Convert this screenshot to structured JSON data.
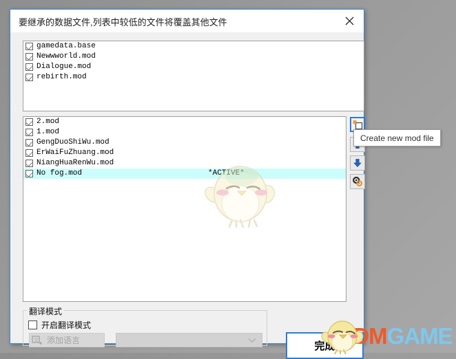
{
  "dialog": {
    "title": "要继承的数据文件,列表中较低的文件将覆盖其他文件",
    "close_icon": "close-icon"
  },
  "inherit_list": {
    "items": [
      {
        "label": "gamedata.base",
        "checked": true
      },
      {
        "label": "Newwworld.mod",
        "checked": true
      },
      {
        "label": "Dialogue.mod",
        "checked": true
      },
      {
        "label": "rebirth.mod",
        "checked": true
      }
    ]
  },
  "mod_list": {
    "active_tag": "*ACTIVE*",
    "items": [
      {
        "label": "2.mod",
        "checked": true,
        "active": false
      },
      {
        "label": "1.mod",
        "checked": true,
        "active": false
      },
      {
        "label": "GengDuoShiWu.mod",
        "checked": true,
        "active": false
      },
      {
        "label": "ErWaiFuZhuang.mod",
        "checked": true,
        "active": false
      },
      {
        "label": "NiangHuaRenWu.mod",
        "checked": true,
        "active": false
      },
      {
        "label": "No fog.mod",
        "checked": true,
        "active": true
      }
    ]
  },
  "toolbar": {
    "new_icon": "new-file-icon",
    "up_icon": "arrow-up-icon",
    "down_icon": "arrow-down-icon",
    "config_icon": "gears-icon"
  },
  "tooltip": {
    "text": "Create new mod file"
  },
  "translate_group": {
    "legend": "翻译模式",
    "checkbox_label": "开启翻译模式",
    "checkbox_checked": false,
    "add_language_label": "添加语言",
    "add_language_icon": "add-language-icon",
    "combo_value": "",
    "combo_chevron_icon": "chevron-down-icon"
  },
  "finish": {
    "label": "完成"
  },
  "watermark": {
    "part1": "3DM",
    "part2": "GAME",
    "color1": "#ee5a2a",
    "color2": "#7ec8ef"
  },
  "colors": {
    "accent": "#2b7cd3",
    "dialog_bg": "#f0f0f0",
    "list_bg": "#ffffff",
    "active_row_bg": "#ccfdfd",
    "desktop_bg": "#9a9a9a"
  }
}
